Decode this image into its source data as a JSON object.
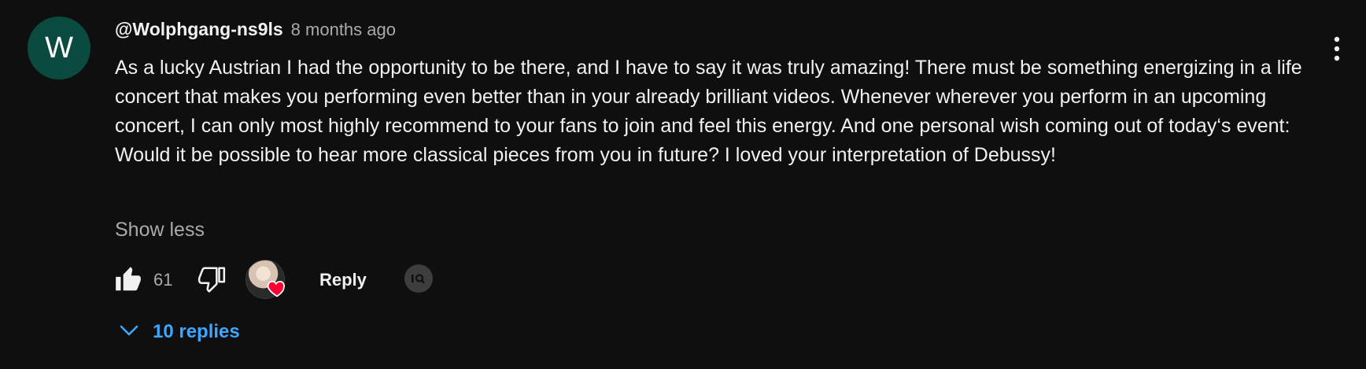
{
  "comment": {
    "avatar_letter": "W",
    "author": "@Wolphgang-ns9ls",
    "time": "8 months ago",
    "text": "As a lucky Austrian I had the opportunity to be there, and I have to say it was truly amazing! There must be something energizing in a life concert that makes you performing even better than in your already brilliant videos. Whenever wherever you perform in an upcoming concert, I  can only most highly recommend to your fans to join and feel this energy. And one personal wish coming out of today‘s event: Would it be possible to hear more classical pieces from you in future? I loved your interpretation of Debussy!",
    "show_less_label": "Show less",
    "like_count": "61",
    "reply_label": "Reply",
    "replies_label": "10 replies"
  },
  "icons": {
    "like": "thumb-up-icon",
    "dislike": "thumb-down-icon",
    "menu": "more-vert-icon",
    "heart": "creator-heart-icon",
    "translate": "translate-icon",
    "expand": "chevron-down-icon"
  },
  "colors": {
    "background": "#0f0f0f",
    "avatar_bg": "#0b4a3f",
    "link_blue": "#3ea6ff",
    "heart_red": "#ff0033",
    "muted_text": "#aaaaaa"
  }
}
